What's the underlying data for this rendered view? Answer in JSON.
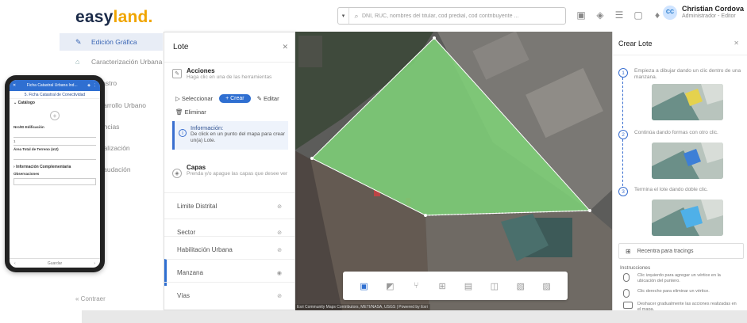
{
  "header": {
    "logo_main": "easy",
    "logo_accent": "land.",
    "search_placeholder": "DNI, RUC, nombres del titular, cod predial, cod contribuyente ...",
    "user_initials": "CC",
    "user_name": "Christian Cordova",
    "user_role": "Administrador - Editor"
  },
  "leftnav": {
    "items": [
      {
        "label": "Edición Gráfica"
      },
      {
        "label": "Caracterización Urbana"
      },
      {
        "label": "Catastro"
      },
      {
        "label": "Desarrollo Urbano"
      },
      {
        "label": "Licencias"
      },
      {
        "label": "Fiscalización"
      },
      {
        "label": "Recaudación"
      }
    ],
    "collapse_label": "Contraer"
  },
  "lote_panel": {
    "title": "Lote",
    "acciones_title": "Acciones",
    "acciones_sub": "Haga clic en una de las herramientas",
    "seleccionar": "Seleccionar",
    "crear": "+ Crear",
    "editar": "Editar",
    "eliminar": "Eliminar",
    "info_title": "Información:",
    "info_text": "De click en un punto del mapa para crear un(a) Lote.",
    "capas_title": "Capas",
    "capas_sub": "Prenda y/o apague las capas que desee ver",
    "layers": [
      {
        "label": "Limite Distrital"
      },
      {
        "label": "Sector"
      },
      {
        "label": "Habilitación Urbana"
      },
      {
        "label": "Manzana"
      },
      {
        "label": "Vías"
      }
    ]
  },
  "crear_panel": {
    "title": "Crear Lote",
    "steps": [
      {
        "num": "1",
        "text": "Empieza a dibujar dando un clic dentro de una manzana."
      },
      {
        "num": "2",
        "text": "Continúa dando formas con otro clic."
      },
      {
        "num": "3",
        "text": "Termina el lote dando doble clic."
      }
    ],
    "recenter": "Recentra para tracings",
    "instructions_title": "Instrucciones",
    "instructions": [
      "Clic izquierdo para agregar un vértice en la ubicación del puntero.",
      "Clic derecho para eliminar un vértice.",
      "Deshacer gradualmente las acciones realizadas en el mapa."
    ]
  },
  "map": {
    "attribution": "Esri Community Maps Contributors, METI/NASA, USGS | Powered by Esri"
  },
  "phone": {
    "title": "Ficha Catastral Urbana Ind...",
    "subtitle": "5. Ficha Catastral de Conectividad",
    "section1": "Catálogo",
    "field1_label": "Nro/ID Edificación",
    "field1_value": "",
    "field2_value": "1",
    "field3_label": "Área Total de Terreno (m2)",
    "section2": "Información Complementaria",
    "obs_label": "Observaciones",
    "footer_mid": "Guardar"
  },
  "colors": {
    "brand": "#1a2a48",
    "accent": "#f0a500",
    "primary": "#2f6fd1",
    "polygon_fill": "#7ed077"
  }
}
